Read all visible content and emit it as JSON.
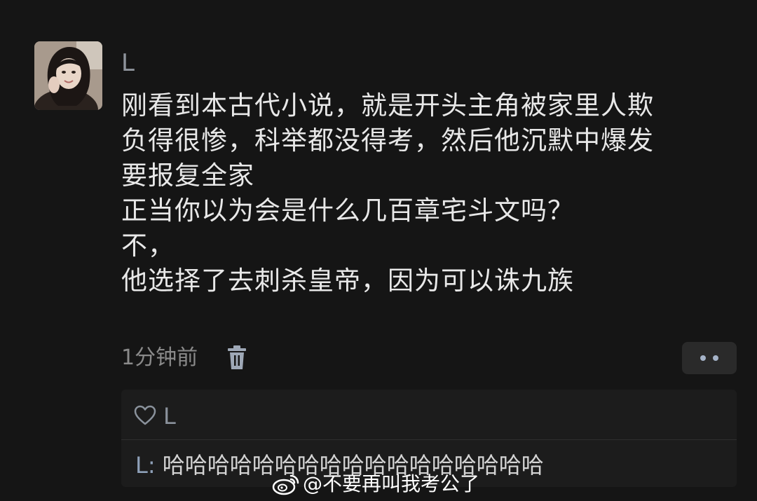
{
  "comment": {
    "username": "L",
    "lines": [
      "刚看到本古代小说，就是开头主角被家里人欺",
      "负得很惨，科举都没得考，然后他沉默中爆发",
      "要报复全家",
      "正当你以为会是什么几百章宅斗文吗？",
      "不，",
      "他选择了去刺杀皇帝，因为可以诛九族"
    ],
    "timestamp": "1分钟前",
    "icons": {
      "delete": "trash-icon",
      "more": "more-icon"
    }
  },
  "replies": {
    "likes": {
      "icon": "heart-icon",
      "names": "L"
    },
    "items": [
      {
        "author": "L:",
        "text": " 哈哈哈哈哈哈哈哈哈哈哈哈哈哈哈哈哈"
      }
    ]
  },
  "watermark": {
    "icon": "weibo-icon",
    "text": "@不要再叫我考公了"
  }
}
